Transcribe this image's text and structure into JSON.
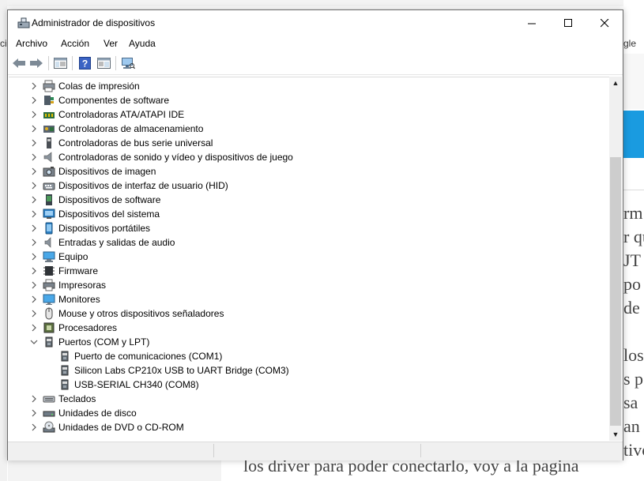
{
  "window": {
    "title": "Administrador de dispositivos"
  },
  "menu": {
    "items": [
      {
        "label": "Archivo"
      },
      {
        "label": "Acción"
      },
      {
        "label": "Ver"
      },
      {
        "label": "Ayuda"
      }
    ]
  },
  "toolbar": {
    "buttons": [
      "back-icon",
      "forward-icon",
      "properties-view-icon",
      "help-icon",
      "driver-view-icon",
      "monitor-scan-icon"
    ]
  },
  "tree": {
    "items": [
      {
        "label": "Colas de impresión",
        "icon": "print-queue-icon",
        "expanded": false
      },
      {
        "label": "Componentes de software",
        "icon": "software-component-icon",
        "expanded": false
      },
      {
        "label": "Controladoras ATA/ATAPI IDE",
        "icon": "ide-controller-icon",
        "expanded": false
      },
      {
        "label": "Controladoras de almacenamiento",
        "icon": "storage-controller-icon",
        "expanded": false
      },
      {
        "label": "Controladoras de bus serie universal",
        "icon": "usb-controller-icon",
        "expanded": false
      },
      {
        "label": "Controladoras de sonido y vídeo y dispositivos de juego",
        "icon": "sound-video-icon",
        "expanded": false
      },
      {
        "label": "Dispositivos de imagen",
        "icon": "imaging-device-icon",
        "expanded": false
      },
      {
        "label": "Dispositivos de interfaz de usuario (HID)",
        "icon": "hid-icon",
        "expanded": false
      },
      {
        "label": "Dispositivos de software",
        "icon": "software-device-icon",
        "expanded": false
      },
      {
        "label": "Dispositivos del sistema",
        "icon": "system-device-icon",
        "expanded": false
      },
      {
        "label": "Dispositivos portátiles",
        "icon": "portable-device-icon",
        "expanded": false
      },
      {
        "label": "Entradas y salidas de audio",
        "icon": "audio-io-icon",
        "expanded": false
      },
      {
        "label": "Equipo",
        "icon": "computer-icon",
        "expanded": false
      },
      {
        "label": "Firmware",
        "icon": "firmware-icon",
        "expanded": false
      },
      {
        "label": "Impresoras",
        "icon": "printer-icon",
        "expanded": false
      },
      {
        "label": "Monitores",
        "icon": "monitor-icon",
        "expanded": false
      },
      {
        "label": "Mouse y otros dispositivos señaladores",
        "icon": "mouse-icon",
        "expanded": false
      },
      {
        "label": "Procesadores",
        "icon": "processor-icon",
        "expanded": false
      },
      {
        "label": "Puertos (COM y LPT)",
        "icon": "port-icon",
        "expanded": true,
        "children": [
          {
            "label": "Puerto de comunicaciones (COM1)",
            "icon": "port-icon"
          },
          {
            "label": "Silicon Labs CP210x USB to UART Bridge (COM3)",
            "icon": "port-icon"
          },
          {
            "label": "USB-SERIAL CH340 (COM8)",
            "icon": "port-icon"
          }
        ]
      },
      {
        "label": "Teclados",
        "icon": "keyboard-icon",
        "expanded": false
      },
      {
        "label": "Unidades de disco",
        "icon": "disk-drive-icon",
        "expanded": false
      },
      {
        "label": "Unidades de DVD o CD-ROM",
        "icon": "dvd-drive-icon",
        "expanded": false
      }
    ]
  },
  "background": {
    "left_text": "ci",
    "right_text": "gle",
    "article_lines": [
      "rm",
      "r qu",
      "JT",
      "po",
      "de",
      "",
      "los",
      "s p",
      "sa",
      "an",
      "tivo"
    ],
    "bottom_text": "los  driver para poder conectarlo, voy a la pagina"
  }
}
